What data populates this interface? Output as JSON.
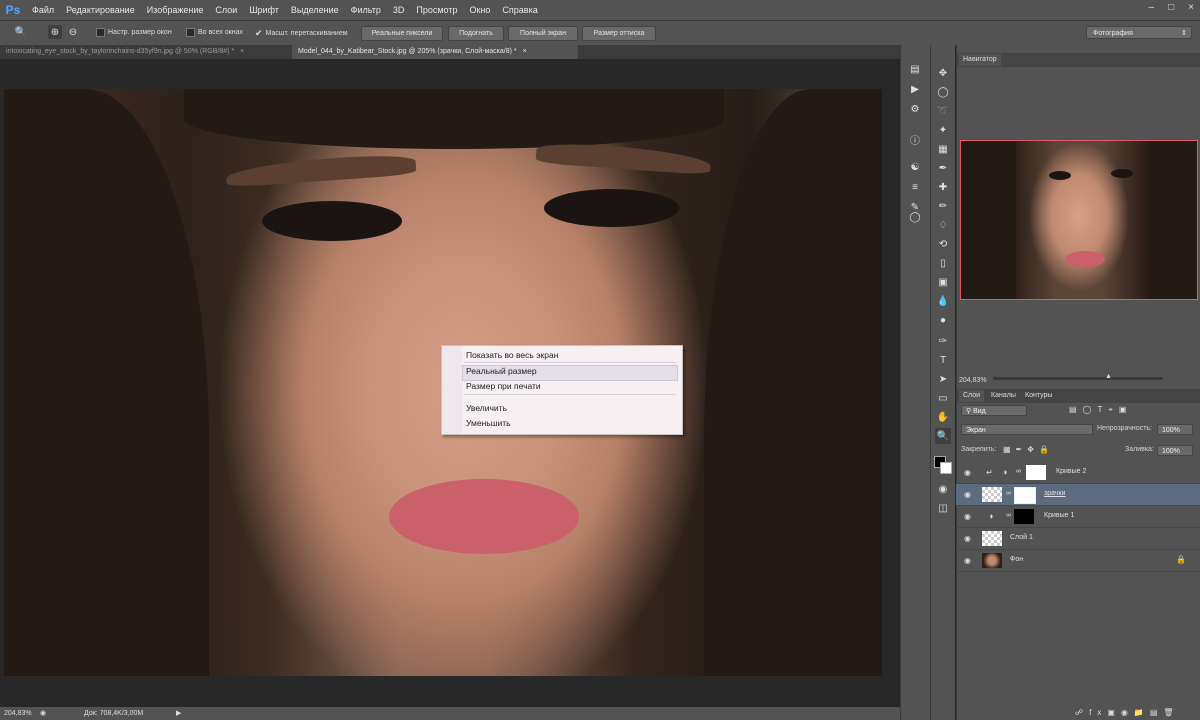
{
  "app": {
    "logo": "Ps"
  },
  "menu": [
    "Файл",
    "Редактирование",
    "Изображение",
    "Слои",
    "Шрифт",
    "Выделение",
    "Фильтр",
    "3D",
    "Просмотр",
    "Окно",
    "Справка"
  ],
  "window_controls": {
    "minimize": "–",
    "maximize": "□",
    "close": "×"
  },
  "options": {
    "resize_windows": "Настр. размер окон",
    "all_windows": "Во всех окнах",
    "scrubby_zoom": "Масшт. перетаскиванием",
    "actual_pixels": "Реальные пиксели",
    "fit_screen": "Подогнать",
    "fill_screen": "Полный экран",
    "print_size": "Размер оттиска",
    "workspace": "Фотография",
    "all_windows_checked": false,
    "resize_windows_checked": false,
    "scrubby_zoom_checked": true
  },
  "tabs": [
    {
      "label": "intoxicating_eye_stock_by_taylorinchains-d35yf9n.jpg @ 50% (RGB/8#) *",
      "close": "×",
      "active": false
    },
    {
      "label": "Model_044_by_Katibear_Stock.jpg @ 205% (зрачки, Слой-маска/8) *",
      "close": "×",
      "active": true
    }
  ],
  "context_menu": [
    "Показать во весь экран",
    "Реальный размер",
    "Размер при печати",
    "Увеличить",
    "Уменьшить"
  ],
  "status": {
    "zoom": "204,83%",
    "doc": "Док: 708,4K/3,00M"
  },
  "navigator": {
    "title": "Навигатор",
    "zoom": "204,83%"
  },
  "layers_panel": {
    "tabs": [
      "Слои",
      "Каналы",
      "Контуры"
    ],
    "kind": "Вид",
    "blend": "Экран",
    "opacity_label": "Непрозрачность:",
    "opacity": "100%",
    "lock_label": "Закрепить:",
    "fill_label": "Заливка:",
    "fill": "100%",
    "layers": [
      {
        "name": "Кривые 2",
        "selected": false
      },
      {
        "name": "зрачки",
        "selected": true
      },
      {
        "name": "Кривые 1",
        "selected": false
      },
      {
        "name": "Слой 1",
        "selected": false
      },
      {
        "name": "Фон",
        "selected": false
      }
    ]
  },
  "colors": {
    "accent": "#4da6ff",
    "nav_frame": "#e05a6a",
    "selected_layer": "#5d6b80"
  }
}
